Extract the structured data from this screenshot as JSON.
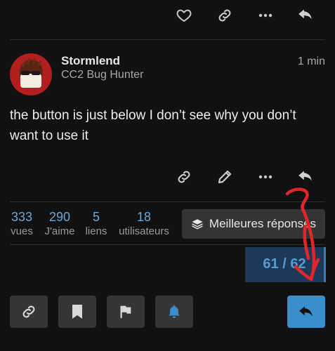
{
  "post": {
    "username": "Stormlend",
    "user_title": "CC2 Bug Hunter",
    "time": "1 min",
    "text": "the button is just below I don’t see why you don’t want to use it"
  },
  "stats": [
    {
      "value": "333",
      "label": "vues"
    },
    {
      "value": "290",
      "label": "J'aime"
    },
    {
      "value": "5",
      "label": "liens"
    },
    {
      "value": "18",
      "label": "utilisateurs"
    }
  ],
  "best_answers_button": "Meilleures réponses",
  "timeline": "61 / 62",
  "icons": {
    "top": [
      "heart-icon",
      "link-icon",
      "more-icon",
      "reply-icon"
    ],
    "post": [
      "link-icon",
      "pencil-icon",
      "more-icon",
      "reply-icon"
    ],
    "bottom": [
      "link-icon",
      "bookmark-icon",
      "flag-icon",
      "bell-icon",
      "reply-icon"
    ]
  },
  "colors": {
    "accent": "#3b8ecc",
    "stat_number": "#6aa9d8",
    "annotation": "#e0262b",
    "avatar_bg": "#b31e1e",
    "bell": "#3b8ecc"
  }
}
